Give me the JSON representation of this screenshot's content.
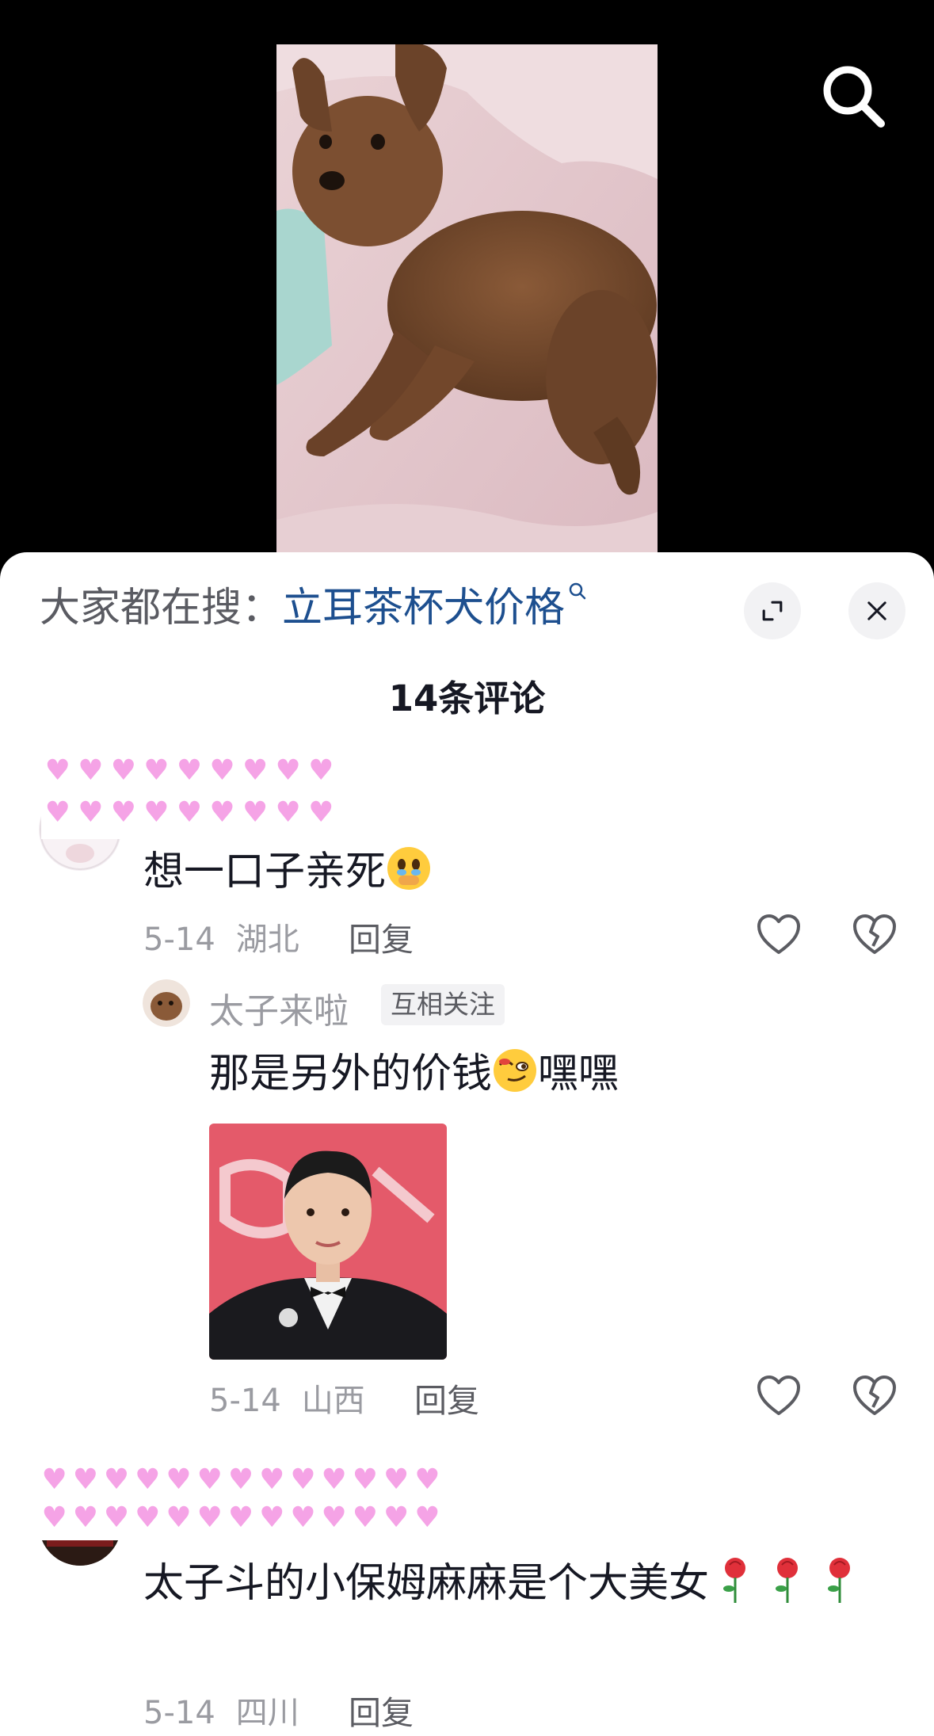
{
  "search_bar": {
    "prefix": "大家都在搜：",
    "term": "立耳茶杯犬价格"
  },
  "comments_header": {
    "count_label": "14条评论"
  },
  "comments": [
    {
      "text": "想一口子亲死",
      "date": "5-14",
      "location": "湖北",
      "reply_label": "回复",
      "replies": [
        {
          "username": "太子来啦",
          "tag": "互相关注",
          "text_a": "那是另外的价钱",
          "text_b": "嘿嘿",
          "date": "5-14",
          "location": "山西",
          "reply_label": "回复"
        }
      ]
    },
    {
      "text": "太子斗的小保姆麻麻是个大美女",
      "date": "5-14",
      "location": "四川",
      "reply_label": "回复"
    }
  ],
  "colors": {
    "accent_link": "#1d4f8f",
    "meta_gray": "#9a9ba1",
    "heart_pink": "#f5a3e6"
  },
  "icons": [
    "search-icon",
    "expand-icon",
    "close-icon",
    "heart-outline-icon",
    "broken-heart-icon",
    "crying-emoji",
    "smirk-emoji",
    "rose-emoji"
  ]
}
